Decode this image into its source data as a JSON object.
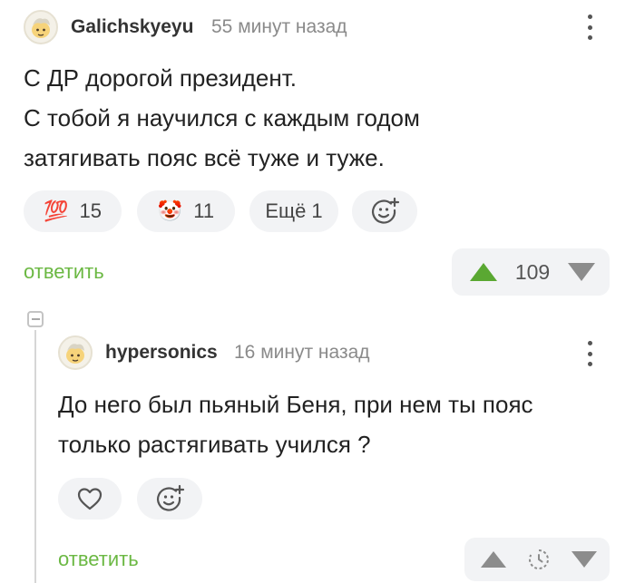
{
  "comment1": {
    "author": "Galichskyeyu",
    "time": "55 минут назад",
    "lines": [
      "С ДР дорогой президент.",
      "С тобой я научился с каждым годом",
      "затягивать пояс всё туже и туже."
    ],
    "reactions": [
      {
        "icon": "hundred-points-emoji",
        "glyph": "💯",
        "count": "15"
      },
      {
        "icon": "clown-face-emoji",
        "glyph": "🤡",
        "count": "11"
      }
    ],
    "more_label": "Ещё 1",
    "reply_label": "ответить",
    "score": "109"
  },
  "comment2": {
    "author": "hypersonics",
    "time": "16 минут назад",
    "lines": [
      "До него был пьяный Беня, при нем ты пояс",
      "только растягивать учился ?"
    ],
    "reply_label": "ответить"
  },
  "colors": {
    "reply_green": "#6bb843",
    "upvote_green": "#5aa832",
    "vote_grey": "#8c8c8c",
    "pill_bg": "#f2f3f5"
  }
}
